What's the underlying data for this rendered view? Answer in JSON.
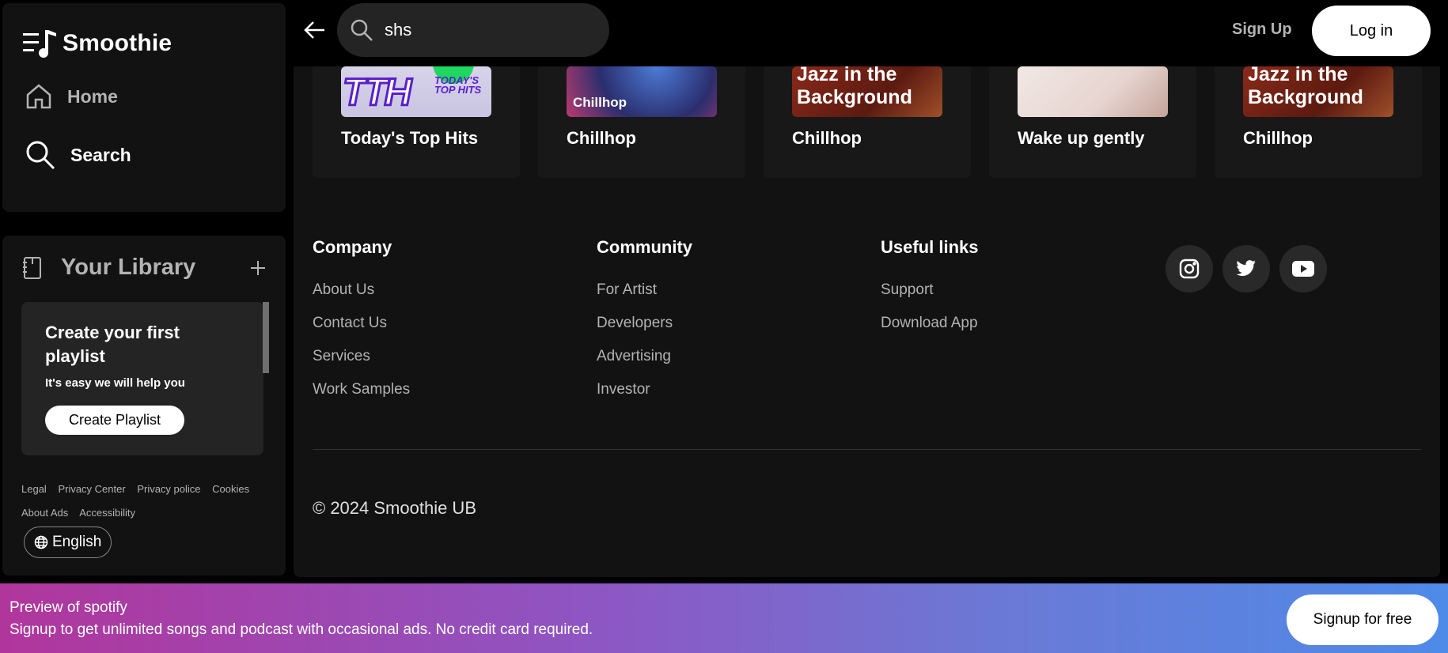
{
  "app": {
    "name": "Smoothie"
  },
  "nav": {
    "home": "Home",
    "search": "Search"
  },
  "library": {
    "title": "Your Library",
    "card_title": "Create your first playlist",
    "card_subtitle": "It's easy we will help you",
    "create_button": "Create Playlist"
  },
  "legal_links": [
    "Legal",
    "Privacy Center",
    "Privacy police",
    "Cookies",
    "About Ads",
    "Accessibility"
  ],
  "language": "English",
  "search": {
    "value": "shs"
  },
  "auth": {
    "signup": "Sign Up",
    "login": "Log in"
  },
  "cards": [
    {
      "title": "Today's Top Hits",
      "art": "TTH",
      "art_sub": "TODAY'S TOP HITS"
    },
    {
      "title": "Chillhop",
      "art": "Chillhop"
    },
    {
      "title": "Chillhop",
      "art": "Jazz in the Background"
    },
    {
      "title": "Wake up gently",
      "art": ""
    },
    {
      "title": "Chillhop",
      "art": "Jazz in the Background"
    }
  ],
  "footer": {
    "company": {
      "heading": "Company",
      "links": [
        "About Us",
        "Contact Us",
        "Services",
        "Work Samples"
      ]
    },
    "community": {
      "heading": "Community",
      "links": [
        "For Artist",
        "Developers",
        "Advertising",
        "Investor"
      ]
    },
    "useful": {
      "heading": "Useful links",
      "links": [
        "Support",
        "Download App"
      ]
    },
    "social": [
      "instagram-icon",
      "twitter-icon",
      "youtube-icon"
    ],
    "copyright": "© 2024 Smoothie UB"
  },
  "banner": {
    "line1": "Preview of spotify",
    "line2": "Signup to get unlimited songs and podcast with occasional ads. No credit card required.",
    "button": "Signup for free"
  },
  "colors": {
    "surface": "#121212",
    "accent_green": "#1ed760",
    "banner_start": "#b0369c",
    "banner_end": "#4e8ae8"
  }
}
